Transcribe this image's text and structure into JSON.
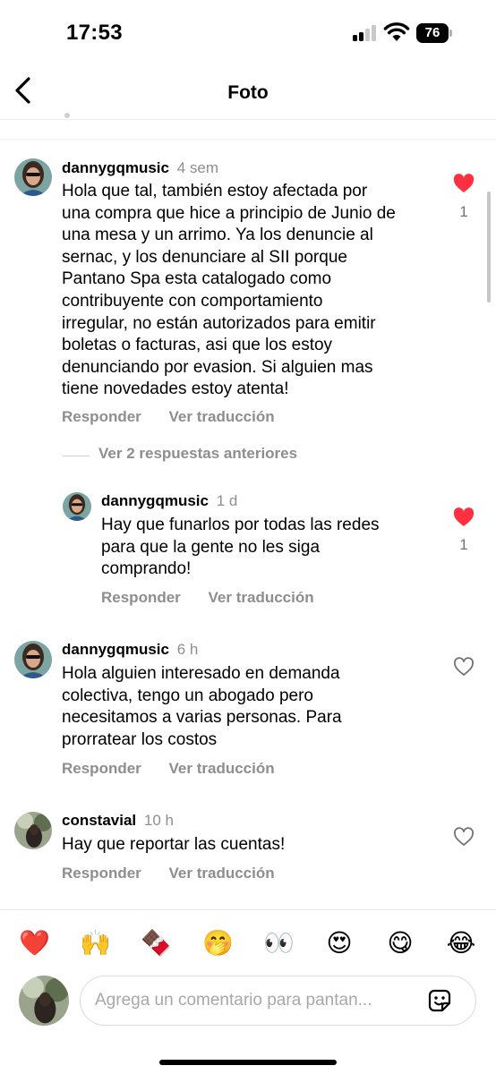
{
  "status_bar": {
    "time": "17:53",
    "battery": "76"
  },
  "header": {
    "title": "Foto"
  },
  "comments": [
    {
      "username": "dannygqmusic",
      "time": "4 sem",
      "text": "Hola que tal, también estoy afectada por\nuna compra que hice a principio de Junio de\nuna mesa y un arrimo. Ya los denuncie al\nsernac, y los denunciare al SII porque\nPantano Spa esta  catalogado como\ncontribuyente con comportamiento\nirregular, no están autorizados para emitir\nboletas o facturas, asi que los estoy\ndenunciando por evasion. Si alguien mas\ntiene novedades estoy atenta!",
      "reply_label": "Responder",
      "translate_label": "Ver traducción",
      "liked": true,
      "like_count": "1"
    },
    {
      "username": "dannygqmusic",
      "time": "1 d",
      "text": "Hay que funarlos por todas las redes\npara que la gente no les siga\ncomprando!",
      "reply_label": "Responder",
      "translate_label": "Ver traducción",
      "liked": true,
      "like_count": "1"
    },
    {
      "username": "dannygqmusic",
      "time": "6 h",
      "text": "Hola alguien interesado en demanda\ncolectiva, tengo un abogado pero\nnecesitamos a varias personas. Para\nprorratear los costos",
      "reply_label": "Responder",
      "translate_label": "Ver traducción",
      "liked": false
    },
    {
      "username": "constavial",
      "time": "10 h",
      "text": "Hay que reportar las cuentas!",
      "reply_label": "Responder",
      "translate_label": "Ver traducción",
      "liked": false
    }
  ],
  "view_replies_label": "Ver 2 respuestas anteriores",
  "emoji_bar": [
    "❤️",
    "🙌",
    "🍫",
    "🤭",
    "👀",
    "😍",
    "😋",
    "😂"
  ],
  "composer": {
    "placeholder": "Agrega un comentario para pantan..."
  },
  "colors": {
    "like_red": "#ff3040",
    "secondary_text": "#8e8e8e"
  }
}
